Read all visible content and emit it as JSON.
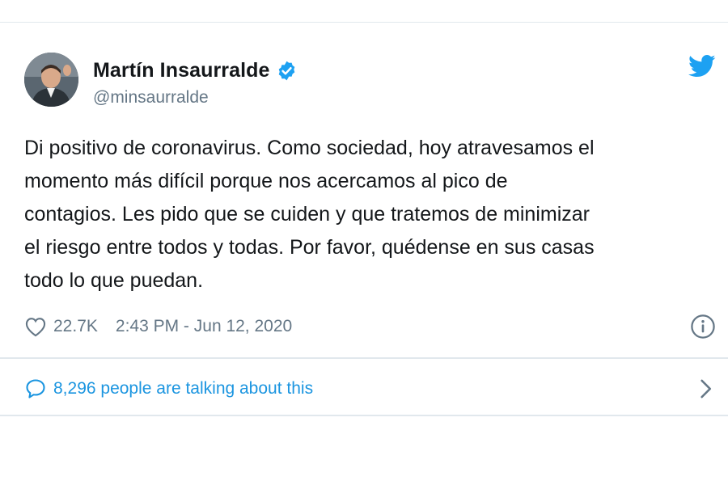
{
  "user": {
    "display_name": "Martín Insaurralde",
    "handle": "@minsaurralde",
    "verified": true,
    "avatar_icon": "user-photo"
  },
  "tweet": {
    "text": "Di positivo de coronavirus. Como sociedad, hoy atravesamos el\nmomento más difícil porque nos acercamos al pico de\ncontagios. Les pido que se cuiden y que tratemos de minimizar\nel riesgo entre todos y todas. Por favor, quédense en sus casas\ntodo lo que puedan.",
    "like_count": "22.7K",
    "timestamp": "2:43 PM - Jun 12, 2020"
  },
  "conversation": {
    "label": "8,296 people are talking about this"
  },
  "colors": {
    "brand_blue": "#1da1f2",
    "link_blue": "#1b95e0",
    "secondary_text": "#657786",
    "border": "#e1e8ed"
  },
  "icons": {
    "brand": "twitter-bird-icon",
    "verified": "verified-badge-icon",
    "like": "heart-icon",
    "info": "info-icon",
    "reply": "speech-bubble-icon",
    "navigate": "chevron-right-icon"
  }
}
